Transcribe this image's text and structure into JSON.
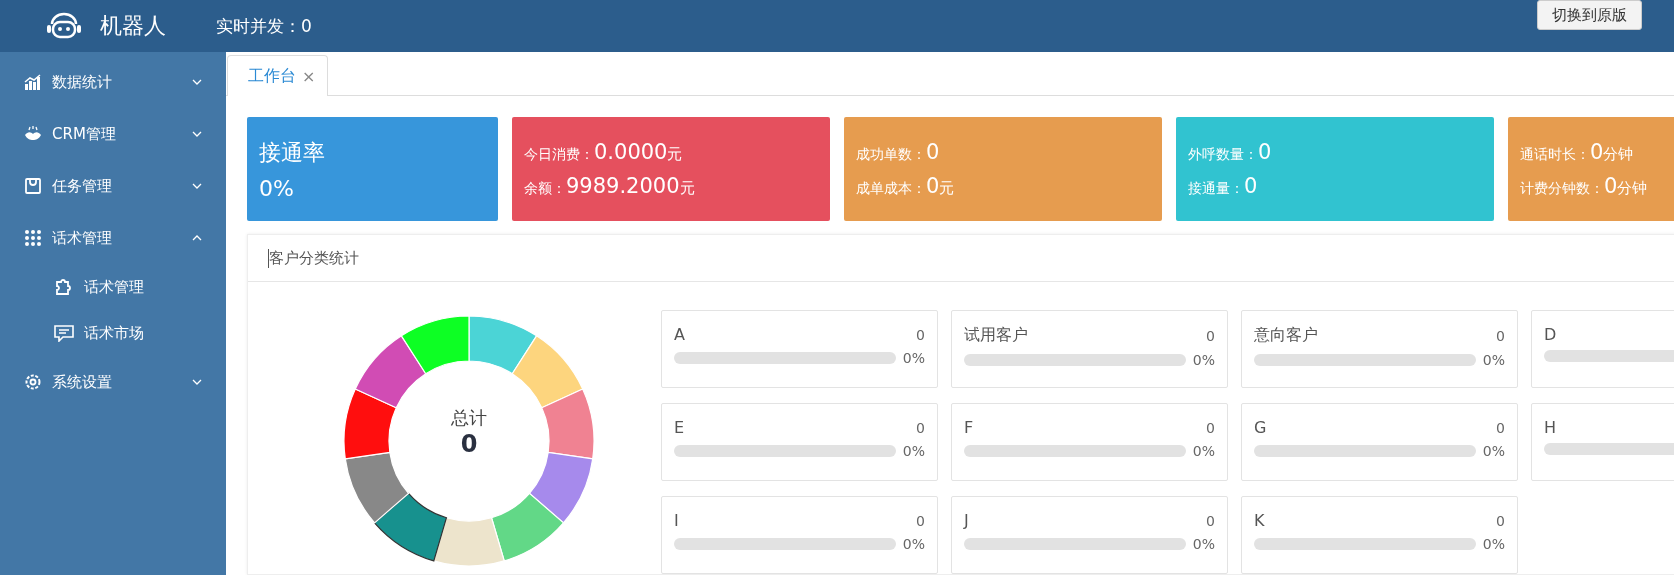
{
  "header": {
    "title": "机器人",
    "concurrency_label": "实时并发：",
    "concurrency_value": "0",
    "switch_button": "切换到原版"
  },
  "sidebar": {
    "items": [
      {
        "label": "数据统计",
        "expanded": false
      },
      {
        "label": "CRM管理",
        "expanded": false
      },
      {
        "label": "任务管理",
        "expanded": false
      },
      {
        "label": "话术管理",
        "expanded": true,
        "children": [
          {
            "label": "话术管理"
          },
          {
            "label": "话术市场"
          }
        ]
      },
      {
        "label": "系统设置",
        "expanded": false
      }
    ]
  },
  "tabs": [
    {
      "label": "工作台",
      "selected": true,
      "close": "×"
    }
  ],
  "stat_cards": [
    {
      "kind": "big",
      "color": "#3796db",
      "title": "接通率",
      "value": "0%"
    },
    {
      "kind": "lines",
      "color": "#e5505e",
      "lines": [
        {
          "label": "今日消费：",
          "value": "0.0000",
          "unit": "元"
        },
        {
          "label": "余额：",
          "value": "9989.2000",
          "unit": "元"
        }
      ]
    },
    {
      "kind": "lines",
      "color": "#e69c4f",
      "lines": [
        {
          "label": "成功单数：",
          "value": "0"
        },
        {
          "label": "成单成本：",
          "value": "0",
          "unit": "元"
        }
      ]
    },
    {
      "kind": "lines",
      "color": "#31c3d0",
      "lines": [
        {
          "label": "外呼数量：",
          "value": "0"
        },
        {
          "label": "接通量：",
          "value": "0"
        }
      ]
    },
    {
      "kind": "lines",
      "color": "#e69c4f",
      "lines": [
        {
          "label": "通话时长：",
          "value": "0",
          "unit": "分钟"
        },
        {
          "label": "计费分钟数：",
          "value": "0",
          "unit": "分钟"
        }
      ]
    }
  ],
  "customer_panel": {
    "title": "客户分类统计",
    "donut": {
      "label": "总计",
      "total": "0"
    },
    "categories": [
      {
        "name": "A",
        "count": "0",
        "percent": "0%",
        "level": 0
      },
      {
        "name": "试用客户",
        "count": "0",
        "percent": "0%",
        "level": 0
      },
      {
        "name": "意向客户",
        "count": "0",
        "percent": "0%",
        "level": 0
      },
      {
        "name": "D",
        "level": 0
      },
      {
        "name": "E",
        "count": "0",
        "percent": "0%",
        "level": 0
      },
      {
        "name": "F",
        "count": "0",
        "percent": "0%",
        "level": 0
      },
      {
        "name": "G",
        "count": "0",
        "percent": "0%",
        "level": 0
      },
      {
        "name": "H",
        "level": 0
      },
      {
        "name": "I",
        "count": "0",
        "percent": "0%",
        "level": 0
      },
      {
        "name": "J",
        "count": "0",
        "percent": "0%",
        "level": 0
      },
      {
        "name": "K",
        "count": "0",
        "percent": "0%",
        "level": 0
      }
    ]
  }
}
